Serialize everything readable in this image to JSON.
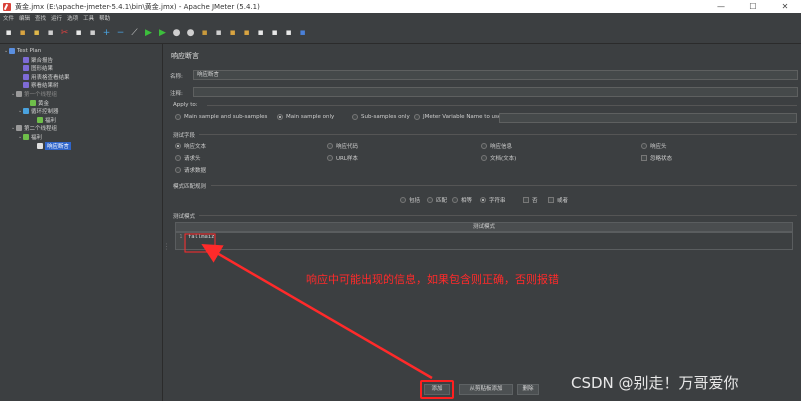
{
  "window": {
    "title": "黄金.jmx (E:\\apache-jmeter-5.4.1\\bin\\黄金.jmx) - Apache JMeter (5.4.1)",
    "minimize": "—",
    "maximize": "☐",
    "close": "✕"
  },
  "menu": [
    "文件",
    "编辑",
    "查找",
    "运行",
    "选项",
    "工具",
    "帮助"
  ],
  "toolbar_icons": [
    {
      "name": "new-icon",
      "glyph": "▪",
      "color": "#e8e8e8"
    },
    {
      "name": "templates-icon",
      "glyph": "▪",
      "color": "#d9a441"
    },
    {
      "name": "open-icon",
      "glyph": "▪",
      "color": "#e0b84a"
    },
    {
      "name": "save-icon",
      "glyph": "▪",
      "color": "#cfcfcf"
    },
    {
      "name": "cut-icon",
      "glyph": "✂",
      "color": "#e04040"
    },
    {
      "name": "copy-icon",
      "glyph": "▪",
      "color": "#e8e8e8"
    },
    {
      "name": "paste-icon",
      "glyph": "▪",
      "color": "#cfcfcf"
    },
    {
      "name": "expand-icon",
      "glyph": "+",
      "color": "#4aa3df"
    },
    {
      "name": "collapse-icon",
      "glyph": "−",
      "color": "#4aa3df"
    },
    {
      "name": "toggle-icon",
      "glyph": "⟋",
      "color": "#cfcfcf"
    },
    {
      "name": "start-icon",
      "glyph": "▶",
      "color": "#3cbf3c"
    },
    {
      "name": "start-no-pause-icon",
      "glyph": "▶",
      "color": "#3cbf3c"
    },
    {
      "name": "stop-icon",
      "glyph": "●",
      "color": "#cfcfcf"
    },
    {
      "name": "shutdown-icon",
      "glyph": "●",
      "color": "#cfcfcf"
    },
    {
      "name": "remote-start-icon",
      "glyph": "▪",
      "color": "#c99a3c"
    },
    {
      "name": "remote-stop-icon",
      "glyph": "▪",
      "color": "#cfcfcf"
    },
    {
      "name": "clear-icon",
      "glyph": "▪",
      "color": "#d9a441"
    },
    {
      "name": "clear-all-icon",
      "glyph": "▪",
      "color": "#d9a441"
    },
    {
      "name": "search-icon",
      "glyph": "▪",
      "color": "#e8e8e8"
    },
    {
      "name": "reset-search-icon",
      "glyph": "▪",
      "color": "#e8e8e8"
    },
    {
      "name": "function-helper-icon",
      "glyph": "▪",
      "color": "#e8e8e8"
    },
    {
      "name": "help-icon",
      "glyph": "▪",
      "color": "#4a80d9"
    }
  ],
  "tree": [
    {
      "label": "Test Plan",
      "icon": "#5a8fe0",
      "expand": "⌄",
      "selected": false,
      "disabled": false
    },
    {
      "label": "聚合报告",
      "icon": "#7e6bd6",
      "expand": "",
      "selected": false,
      "disabled": false
    },
    {
      "label": "图形结果",
      "icon": "#7e6bd6",
      "expand": "",
      "selected": false,
      "disabled": false
    },
    {
      "label": "用表格查看结果",
      "icon": "#7e6bd6",
      "expand": "",
      "selected": false,
      "disabled": false
    },
    {
      "label": "察看结果树",
      "icon": "#7e6bd6",
      "expand": "",
      "selected": false,
      "disabled": false
    },
    {
      "label": "第一个线程组",
      "icon": "#9a9a9a",
      "expand": "⌄",
      "selected": false,
      "disabled": true
    },
    {
      "label": "黄金",
      "icon": "#6fbf4a",
      "expand": "",
      "selected": false,
      "disabled": false
    },
    {
      "label": "循环控制器",
      "icon": "#4aa3df",
      "expand": "⌄",
      "selected": false,
      "disabled": false
    },
    {
      "label": "福利",
      "icon": "#6fbf4a",
      "expand": "",
      "selected": false,
      "disabled": false
    },
    {
      "label": "第二个线程组",
      "icon": "#9a9a9a",
      "expand": "⌄",
      "selected": false,
      "disabled": false
    },
    {
      "label": "福利",
      "icon": "#6fbf4a",
      "expand": "⌄",
      "selected": false,
      "disabled": false
    },
    {
      "label": "响应断言",
      "icon": "#e0e0e0",
      "expand": "",
      "selected": true,
      "disabled": false
    }
  ],
  "panel": {
    "title": "响应断言",
    "name_label": "名称:",
    "name_value": "响应断言",
    "comment_label": "注释:",
    "comment_value": "",
    "apply_to": {
      "title": "Apply to:",
      "options": [
        {
          "label": "Main sample and sub-samples",
          "on": false
        },
        {
          "label": "Main sample only",
          "on": true
        },
        {
          "label": "Sub-samples only",
          "on": false
        },
        {
          "label": "JMeter Variable Name to use",
          "on": false
        }
      ],
      "variable_value": ""
    },
    "test_field": {
      "title": "测试字段",
      "options": [
        {
          "label": "响应文本",
          "on": true
        },
        {
          "label": "响应代码",
          "on": false
        },
        {
          "label": "响应信息",
          "on": false
        },
        {
          "label": "响应头",
          "on": false
        },
        {
          "label": "请求头",
          "on": false
        },
        {
          "label": "URL样本",
          "on": false
        },
        {
          "label": "文档(文本)",
          "on": false
        },
        {
          "label": "忽略状态",
          "on": false,
          "checkbox": true
        },
        {
          "label": "请求数据",
          "on": false
        }
      ]
    },
    "pattern_rules": {
      "title": "模式匹配规则",
      "options": [
        {
          "label": "包括",
          "on": false
        },
        {
          "label": "匹配",
          "on": false
        },
        {
          "label": "相等",
          "on": false
        },
        {
          "label": "字符串",
          "on": true
        }
      ],
      "checks": [
        {
          "label": "否",
          "on": false
        },
        {
          "label": "或者",
          "on": false
        }
      ]
    },
    "patterns": {
      "title": "测试模式",
      "column": "测试模式",
      "rows": [
        {
          "index": "1",
          "value": "fallmaiz"
        }
      ]
    },
    "buttons": {
      "add": "添加",
      "add_clipboard": "从剪贴板添加",
      "delete": "删除"
    }
  },
  "annotation": "响应中可能出现的信息，如果包含则正确，否则报错",
  "watermark": "CSDN @别走！万哥爱你"
}
